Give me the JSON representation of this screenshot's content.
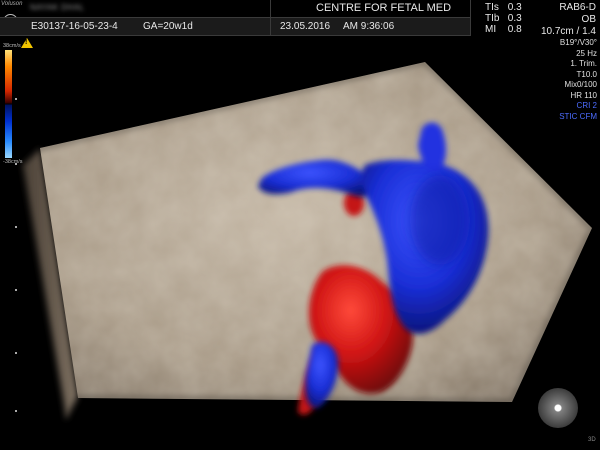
{
  "header": {
    "brand": "Voluson",
    "logo": "GE",
    "patient_name_blurred": "NAYAK DHAL",
    "centre": "CENTRE FOR FETAL MED",
    "patient_id": "E30137-16-05-23-4",
    "ga": "GA=20w1d",
    "date": "23.05.2016",
    "time": "AM 9:36:06"
  },
  "indices": [
    {
      "label": "TIs",
      "value": "0.3"
    },
    {
      "label": "TIb",
      "value": "0.3"
    },
    {
      "label": "MI",
      "value": "0.8"
    }
  ],
  "probe": {
    "name": "RAB6-D",
    "mode": "OB",
    "depth": "10.7cm / 1.4"
  },
  "params": [
    "B19°/V30°",
    "25 Hz",
    "1. Trim.",
    "T10.0",
    "Mix0/100",
    "HR 110"
  ],
  "params_blue": [
    "CRI 2",
    "STIC CFM"
  ],
  "colorbar": {
    "top": "38cm/s",
    "bottom": "-38cm/s"
  },
  "corner_label": "3D",
  "colors": {
    "flow_red": "#d81818",
    "flow_blue": "#1a2fd8",
    "tissue": "#b8aa97"
  }
}
